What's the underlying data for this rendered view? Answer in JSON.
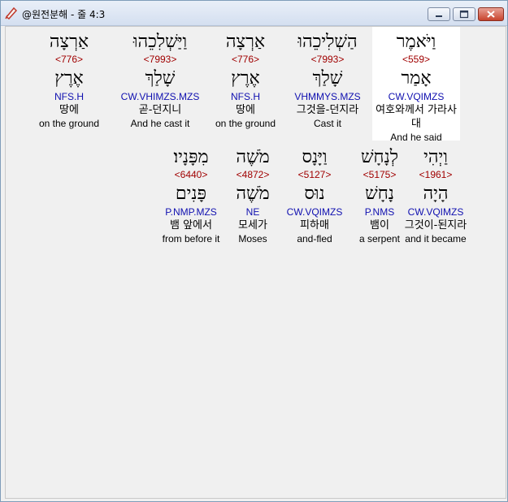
{
  "window": {
    "title": "@원전분해 - 줄 4:3"
  },
  "rows": [
    {
      "words": [
        {
          "hebrew": "וַיֹּאמֶר",
          "strong": "<559>",
          "root": "אָמַר",
          "morph": "CW.VQIMZS",
          "korean": "여호와께서 가라사대",
          "english": "And he said",
          "selected": true
        },
        {
          "hebrew": "הַשְׁלִיכֵהוּ",
          "strong": "<7993>",
          "root": "שָׁלַךְ",
          "morph": "VHMMYS.MZS",
          "korean": "그것을-던지라",
          "english": "Cast it",
          "selected": false
        },
        {
          "hebrew": "אַרְצָה",
          "strong": "<776>",
          "root": "אֶרֶץ",
          "morph": "NFS.H",
          "korean": "땅에",
          "english": "on the ground",
          "selected": false
        },
        {
          "hebrew": "וַיַּשְׁלִכֵהוּ",
          "strong": "<7993>",
          "root": "שָׁלַךְ",
          "morph": "CW.VHIMZS.MZS",
          "korean": "곧-던지니",
          "english": "And he cast it",
          "selected": false
        },
        {
          "hebrew": "אַרְצָה",
          "strong": "<776>",
          "root": "אֶרֶץ",
          "morph": "NFS.H",
          "korean": "땅에",
          "english": "on the ground",
          "selected": false
        }
      ]
    },
    {
      "words": [
        {
          "hebrew": "וַיְהִי",
          "strong": "<1961>",
          "root": "הָיָה",
          "morph": "CW.VQIMZS",
          "korean": "그것이-된지라",
          "english": "and it became",
          "selected": false
        },
        {
          "hebrew": "לְנָחָשׁ",
          "strong": "<5175>",
          "root": "נָחָשׁ",
          "morph": "P.NMS",
          "korean": "뱀이",
          "english": "a serpent",
          "selected": false
        },
        {
          "hebrew": "וַיָּנָס",
          "strong": "<5127>",
          "root": "נוּס",
          "morph": "CW.VQIMZS",
          "korean": "피하매",
          "english": "and-fled",
          "selected": false
        },
        {
          "hebrew": "מֹשֶׁה",
          "strong": "<4872>",
          "root": "מֹשֶׁה",
          "morph": "NE",
          "korean": "모세가",
          "english": "Moses",
          "selected": false
        },
        {
          "hebrew": "מִפָּנָיו׃",
          "strong": "<6440>",
          "root": "פָּנִים",
          "morph": "P.NMP.MZS",
          "korean": "뱀 앞에서",
          "english": "from before it",
          "selected": false
        }
      ]
    }
  ],
  "colors": {
    "strong": "#a00000",
    "morph": "#1010b0",
    "selected_bg": "#ffffff"
  }
}
